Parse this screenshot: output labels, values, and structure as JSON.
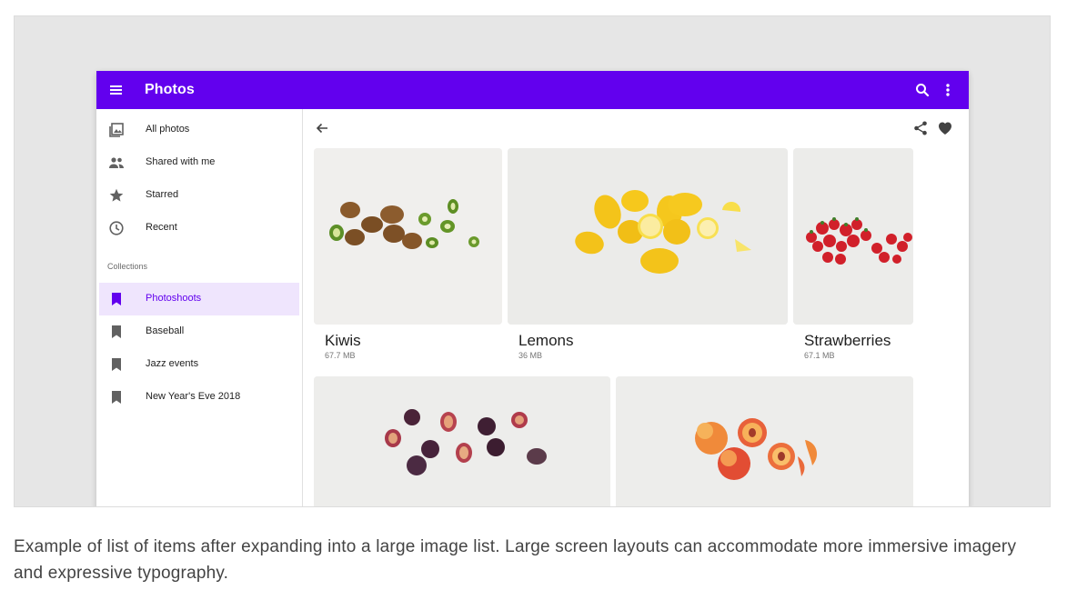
{
  "app": {
    "title": "Photos",
    "accent_color": "#6200ee",
    "icons": {
      "menu": "menu-icon",
      "search": "search-icon",
      "more": "more-vert-icon"
    }
  },
  "drawer": {
    "items": [
      {
        "label": "All photos",
        "icon": "photo-library-icon"
      },
      {
        "label": "Shared with me",
        "icon": "people-icon"
      },
      {
        "label": "Starred",
        "icon": "star-icon"
      },
      {
        "label": "Recent",
        "icon": "clock-icon"
      }
    ],
    "collections_label": "Collections",
    "collections": [
      {
        "label": "Photoshoots",
        "icon": "bookmark-icon",
        "selected": true
      },
      {
        "label": "Baseball",
        "icon": "bookmark-icon",
        "selected": false
      },
      {
        "label": "Jazz events",
        "icon": "bookmark-icon",
        "selected": false
      },
      {
        "label": "New Year's Eve 2018",
        "icon": "bookmark-icon",
        "selected": false
      }
    ]
  },
  "content": {
    "icons": {
      "back": "arrow-back-icon",
      "share": "share-icon",
      "favorite": "heart-icon"
    },
    "cards": [
      {
        "name": "Kiwis",
        "size": "67.7 MB"
      },
      {
        "name": "Lemons",
        "size": "36 MB"
      },
      {
        "name": "Strawberries",
        "size": "67.1 MB"
      },
      {
        "name": "",
        "size": ""
      },
      {
        "name": "",
        "size": ""
      }
    ]
  },
  "caption": "Example of list of items after expanding into a large image list. Large screen layouts can accommodate more immersive imagery and expressive typography."
}
